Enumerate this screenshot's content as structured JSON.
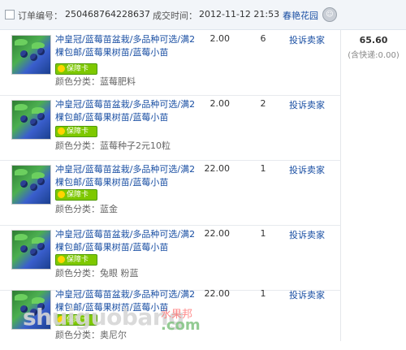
{
  "header": {
    "order_label": "订单编号：",
    "order_number": "250468764228637",
    "time_label": "成交时间：",
    "time_value": "2012-11-12 21:53",
    "shop_name": "春艳花园"
  },
  "summary": {
    "total": "65.60",
    "shipping": "(含快递:0.00)"
  },
  "items": [
    {
      "title": "冲皇冠/蓝莓苗盆栽/多品种可选/满2棵包邮/蓝莓果树苗/蓝莓小苗",
      "badge": "保障卡",
      "color": "颜色分类：蓝莓肥料",
      "price": "2.00",
      "qty": "6",
      "action": "投诉卖家"
    },
    {
      "title": "冲皇冠/蓝莓苗盆栽/多品种可选/满2棵包邮/蓝莓果树苗/蓝莓小苗",
      "badge": "保障卡",
      "color": "颜色分类：蓝莓种子2元10粒",
      "price": "2.00",
      "qty": "2",
      "action": "投诉卖家"
    },
    {
      "title": "冲皇冠/蓝莓苗盆栽/多品种可选/满2棵包邮/蓝莓果树苗/蓝莓小苗",
      "badge": "保障卡",
      "color": "颜色分类：蓝金",
      "price": "22.00",
      "qty": "1",
      "action": "投诉卖家"
    },
    {
      "title": "冲皇冠/蓝莓苗盆栽/多品种可选/满2棵包邮/蓝莓果树苗/蓝莓小苗",
      "badge": "保障卡",
      "color": "颜色分类：兔眼 粉蓝",
      "price": "22.00",
      "qty": "1",
      "action": "投诉卖家"
    },
    {
      "title": "冲皇冠/蓝莓苗盆栽/多品种可选/满2棵包邮/蓝莓果树苗/蓝莓小苗",
      "badge": "保障卡",
      "color": "颜色分类：奥尼尔",
      "price": "22.00",
      "qty": "1",
      "action": "投诉卖家"
    }
  ],
  "watermark": {
    "main": "shuiguobang",
    "cn": "水果邦",
    "com": ".com"
  }
}
